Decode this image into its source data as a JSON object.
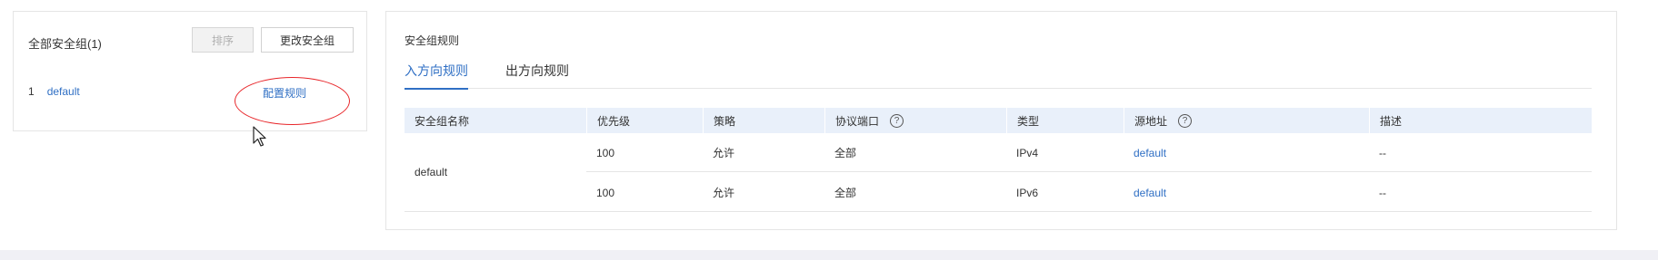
{
  "left": {
    "title": "全部安全组(1)",
    "sort_button": "排序",
    "change_button": "更改安全组",
    "groups": [
      {
        "index": "1",
        "name": "default",
        "action": "配置规则"
      }
    ]
  },
  "right": {
    "title": "安全组规则",
    "tabs": [
      {
        "label": "入方向规则",
        "active": true
      },
      {
        "label": "出方向规则",
        "active": false
      }
    ],
    "columns": [
      "安全组名称",
      "优先级",
      "策略",
      "协议端口",
      "类型",
      "源地址",
      "描述"
    ],
    "group_name": "default",
    "rows": [
      {
        "priority": "100",
        "policy": "允许",
        "port": "全部",
        "type": "IPv4",
        "source": "default",
        "desc": "--"
      },
      {
        "priority": "100",
        "policy": "允许",
        "port": "全部",
        "type": "IPv6",
        "source": "default",
        "desc": "--"
      }
    ]
  },
  "colors": {
    "accent": "#2f6fc4",
    "annotation": "#e8262a",
    "header_bg": "#e9f0fa"
  },
  "icons": [
    "question-circle-icon",
    "mouse-cursor-icon"
  ]
}
